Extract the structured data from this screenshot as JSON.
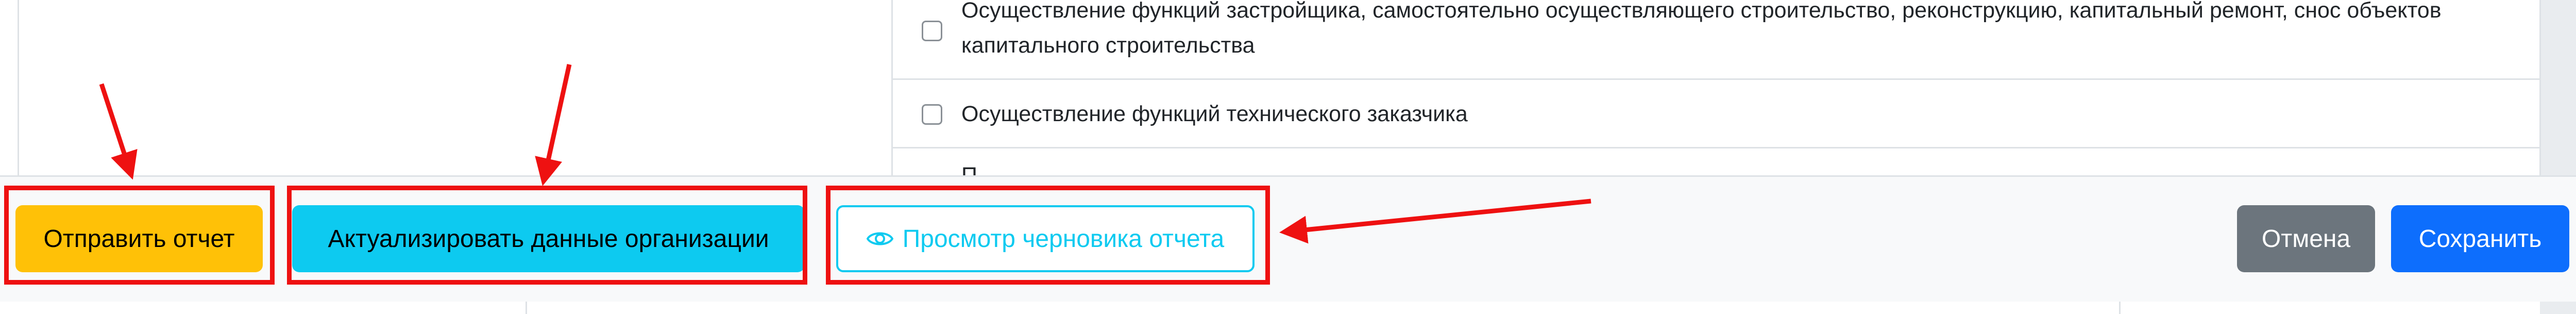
{
  "list": {
    "items": [
      {
        "line1": "Осуществление функций застройщика, самостоятельно осуществляющего строительство, реконструкцию, капитальный ремонт, снос объектов",
        "line2": "капитального строительства"
      },
      {
        "line1": "Осуществление функций технического заказчика"
      },
      {
        "line1": "П"
      }
    ]
  },
  "footer": {
    "send_report_label": "Отправить отчет",
    "update_org_label": "Актуализировать данные организации",
    "preview_draft_label": "Просмотр черновика отчета",
    "cancel_label": "Отмена",
    "save_label": "Сохранить"
  },
  "icons": {
    "preview": "eye-icon"
  },
  "colors": {
    "warning": "#ffc107",
    "info": "#0dcaf0",
    "secondary": "#6c757d",
    "primary": "#0d6efd",
    "annotation": "#ee1111"
  }
}
